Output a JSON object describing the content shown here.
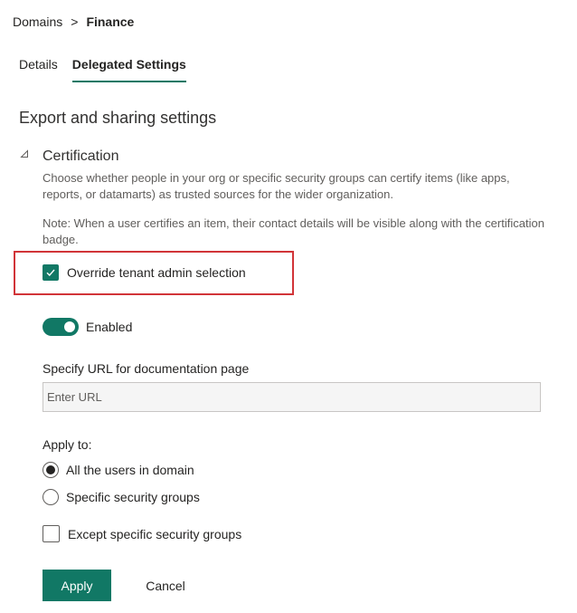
{
  "breadcrumb": {
    "root": "Domains",
    "separator": ">",
    "current": "Finance"
  },
  "tabs": [
    {
      "label": "Details",
      "active": false
    },
    {
      "label": "Delegated Settings",
      "active": true
    }
  ],
  "section": {
    "title": "Export and sharing settings"
  },
  "certification": {
    "collapse_icon": "collapse-triangle-icon",
    "title": "Certification",
    "description": "Choose whether people in your org or specific security groups can certify items (like apps, reports, or datamarts) as trusted sources for the wider organization.",
    "note": "Note: When a user certifies an item, their contact details will be visible along with the certification badge.",
    "override": {
      "label": "Override tenant admin selection",
      "checked": true
    },
    "toggle": {
      "label": "Enabled",
      "on": true
    },
    "url": {
      "label": "Specify URL for documentation page",
      "placeholder": "Enter URL",
      "value": ""
    },
    "apply_to": {
      "label": "Apply to:",
      "options": [
        {
          "label": "All the users in domain",
          "selected": true
        },
        {
          "label": "Specific security groups",
          "selected": false
        }
      ]
    },
    "except": {
      "label": "Except specific security groups",
      "checked": false
    }
  },
  "actions": {
    "apply": "Apply",
    "cancel": "Cancel"
  },
  "colors": {
    "accent": "#117865",
    "highlight": "#d13438"
  }
}
